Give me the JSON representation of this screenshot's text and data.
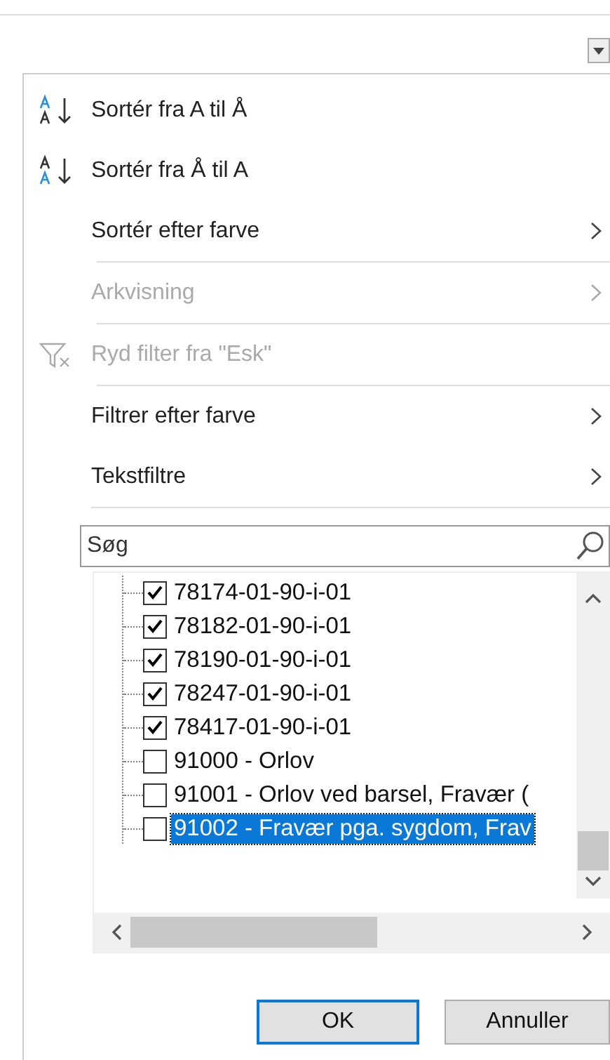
{
  "menu": [
    {
      "label": "Sortér fra A til Å",
      "kind": "sort_az",
      "disabled": false,
      "submenu": false
    },
    {
      "label": "Sortér fra Å til A",
      "kind": "sort_za",
      "disabled": false,
      "submenu": false
    },
    {
      "label": "Sortér efter farve",
      "kind": "plain",
      "disabled": false,
      "submenu": true
    },
    {
      "label": "Arkvisning",
      "kind": "plain",
      "disabled": true,
      "submenu": true
    },
    {
      "label": "Ryd filter fra \"Esk\"",
      "kind": "clear_filter",
      "disabled": true,
      "submenu": false
    },
    {
      "label": "Filtrer efter farve",
      "kind": "plain",
      "disabled": false,
      "submenu": true
    },
    {
      "label": "Tekstfiltre",
      "kind": "plain",
      "disabled": false,
      "submenu": true
    }
  ],
  "search": {
    "placeholder": "Søg"
  },
  "values": [
    {
      "label": "78174-01-90-i-01",
      "checked": true,
      "selected": false
    },
    {
      "label": "78182-01-90-i-01",
      "checked": true,
      "selected": false
    },
    {
      "label": "78190-01-90-i-01",
      "checked": true,
      "selected": false
    },
    {
      "label": "78247-01-90-i-01",
      "checked": true,
      "selected": false
    },
    {
      "label": "78417-01-90-i-01",
      "checked": true,
      "selected": false
    },
    {
      "label": "91000 - Orlov",
      "checked": false,
      "selected": false
    },
    {
      "label": "91001 - Orlov ved barsel, Fravær (",
      "checked": false,
      "selected": false
    },
    {
      "label": "91002 - Fravær pga. sygdom, Frav",
      "checked": false,
      "selected": true
    }
  ],
  "buttons": [
    {
      "label": "OK",
      "default": true
    },
    {
      "label": "Annuller",
      "default": false
    }
  ]
}
